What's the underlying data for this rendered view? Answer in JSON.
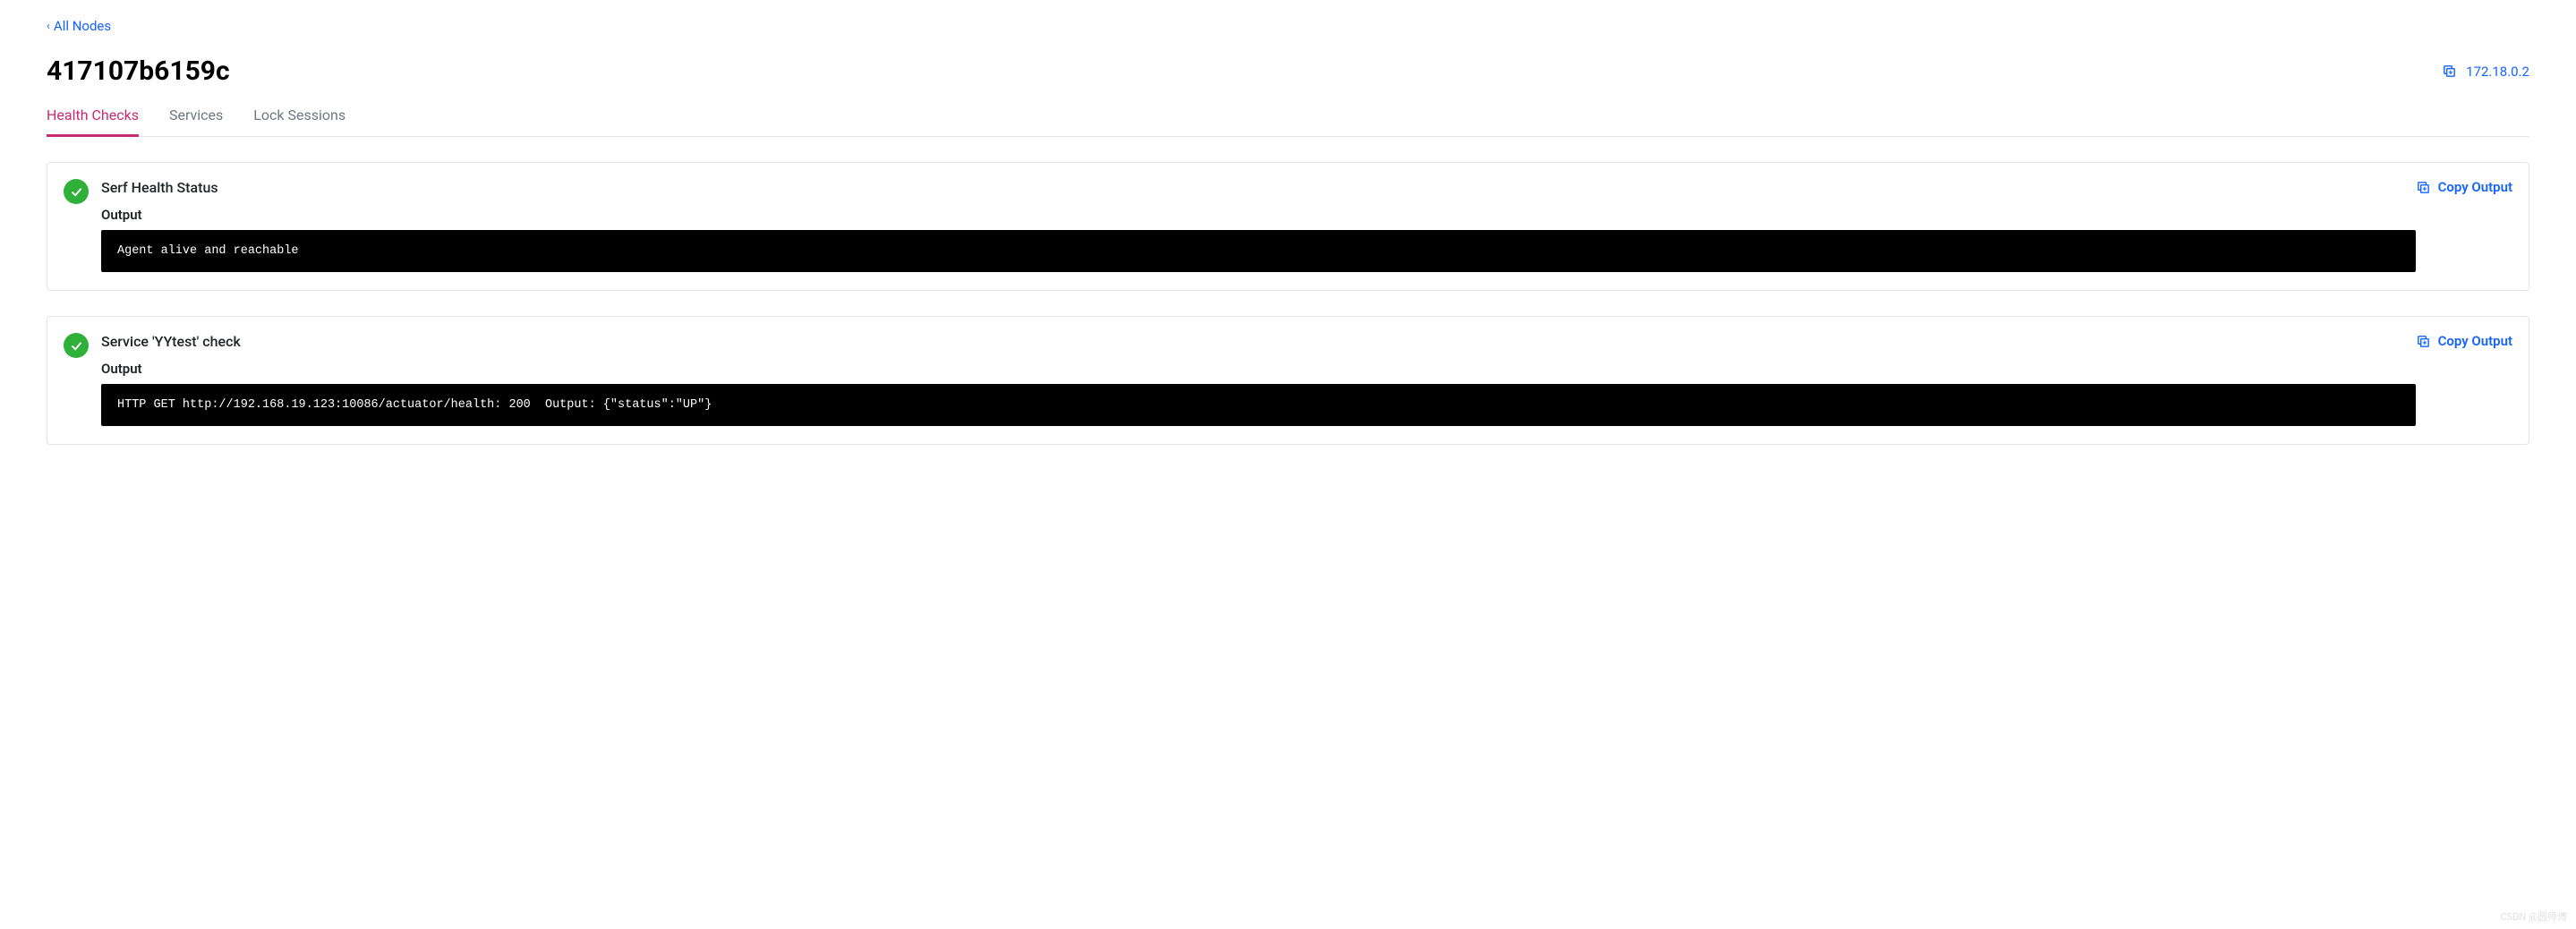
{
  "breadcrumb": {
    "back_label": "All Nodes"
  },
  "header": {
    "title": "417107b6159c",
    "ip_address": "172.18.0.2"
  },
  "tabs": [
    {
      "label": "Health Checks",
      "active": true
    },
    {
      "label": "Services",
      "active": false
    },
    {
      "label": "Lock Sessions",
      "active": false
    }
  ],
  "copy_output_label": "Copy Output",
  "output_label": "Output",
  "checks": [
    {
      "status": "passing",
      "title": "Serf Health Status",
      "output": "Agent alive and reachable"
    },
    {
      "status": "passing",
      "title": "Service 'YYtest' check",
      "output": "HTTP GET http://192.168.19.123:10086/actuator/health: 200  Output: {\"status\":\"UP\"}"
    }
  ],
  "watermark": "CSDN @圆师傅"
}
